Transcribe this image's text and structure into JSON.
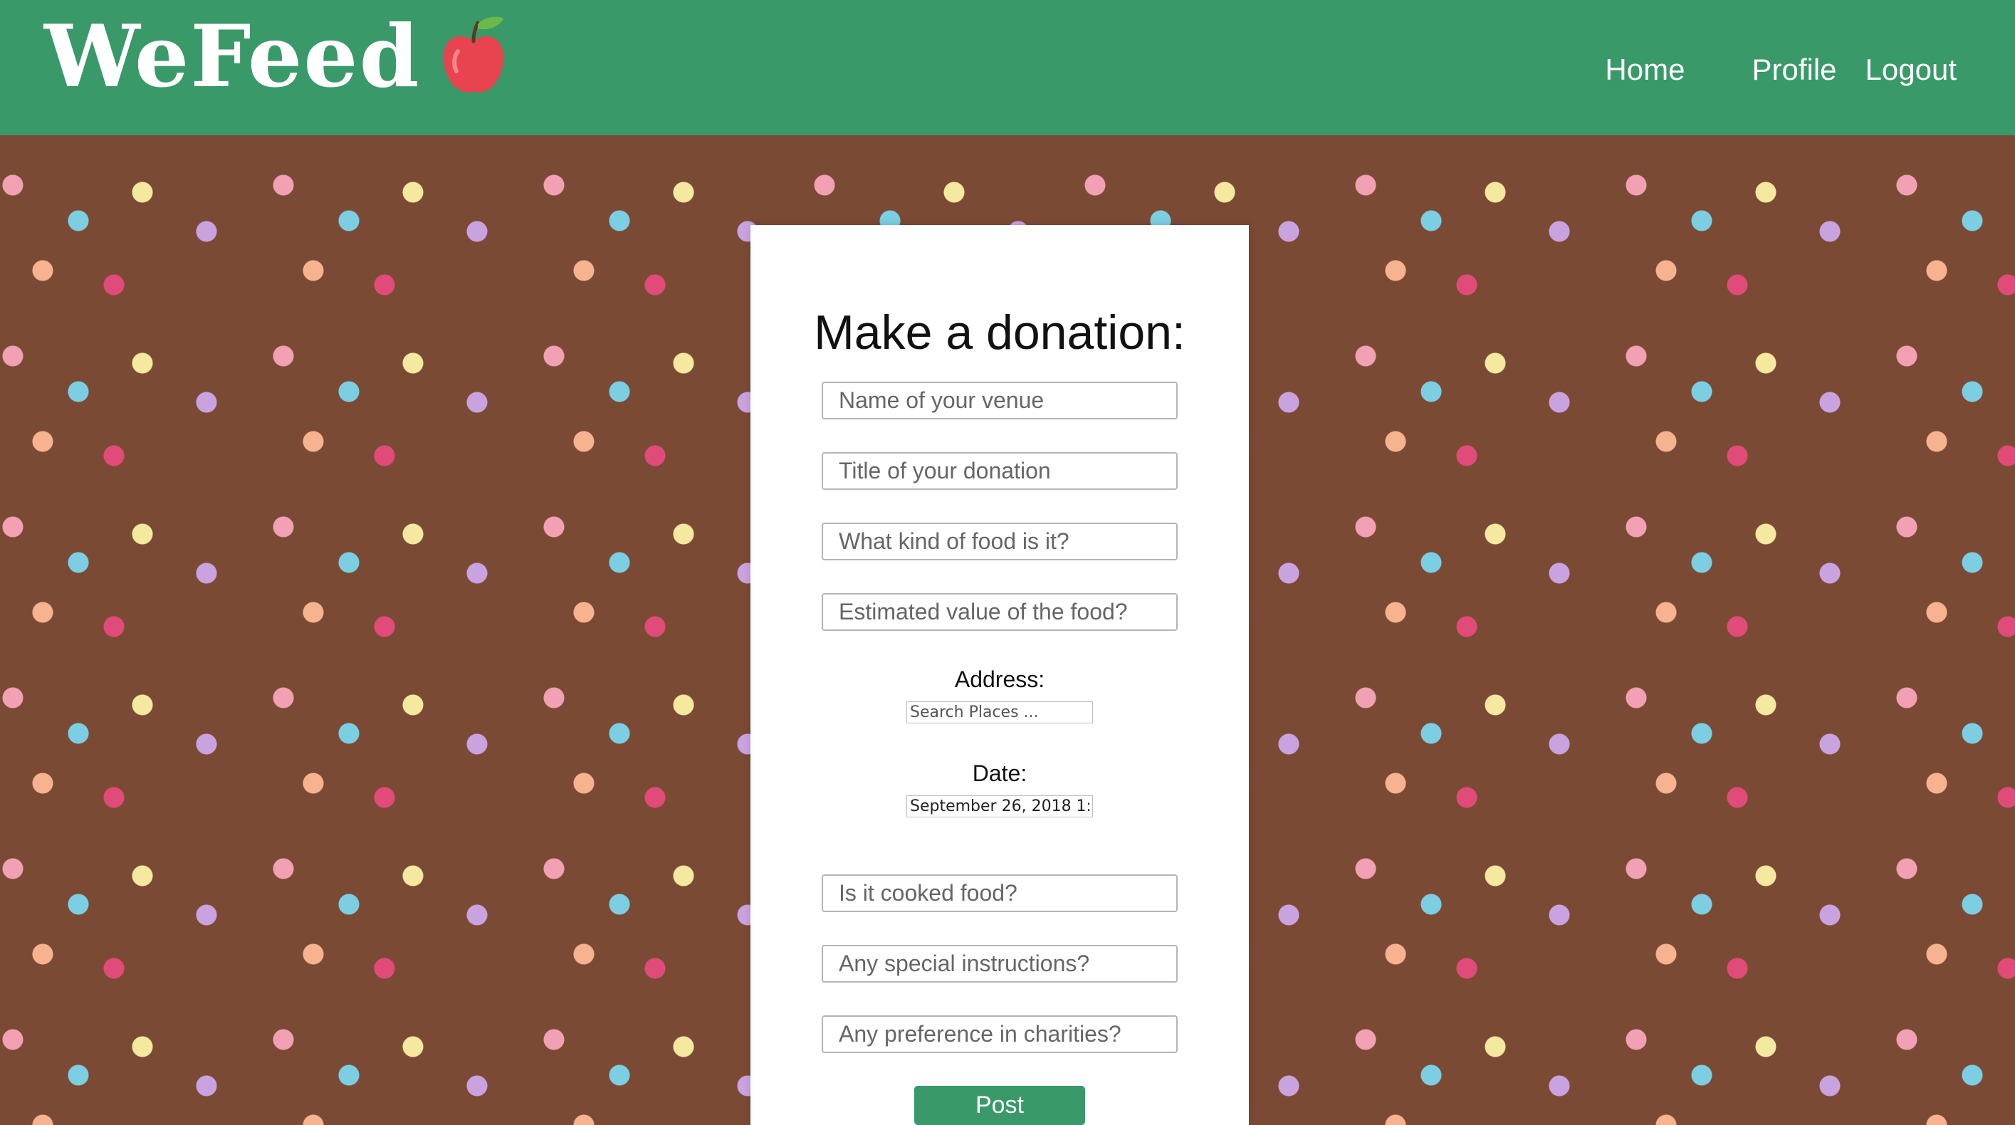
{
  "header": {
    "logo_text": "WeFeed",
    "nav": {
      "home": "Home",
      "profile": "Profile",
      "logout": "Logout"
    }
  },
  "form": {
    "title": "Make a donation:",
    "venue_placeholder": "Name of your venue",
    "donation_title_placeholder": "Title of your donation",
    "food_kind_placeholder": "What kind of food is it?",
    "value_placeholder": "Estimated value of the food?",
    "address_label": "Address:",
    "address_placeholder": "Search Places ...",
    "date_label": "Date:",
    "date_value": "September 26, 2018 1:5",
    "cooked_placeholder": "Is it cooked food?",
    "instructions_placeholder": "Any special instructions?",
    "charities_placeholder": "Any preference in charities?",
    "post_button": "Post"
  },
  "colors": {
    "brand_green": "#3a9968",
    "background_mint": "#aee8d6"
  },
  "icons": {
    "logo_icon": "apple-icon"
  }
}
